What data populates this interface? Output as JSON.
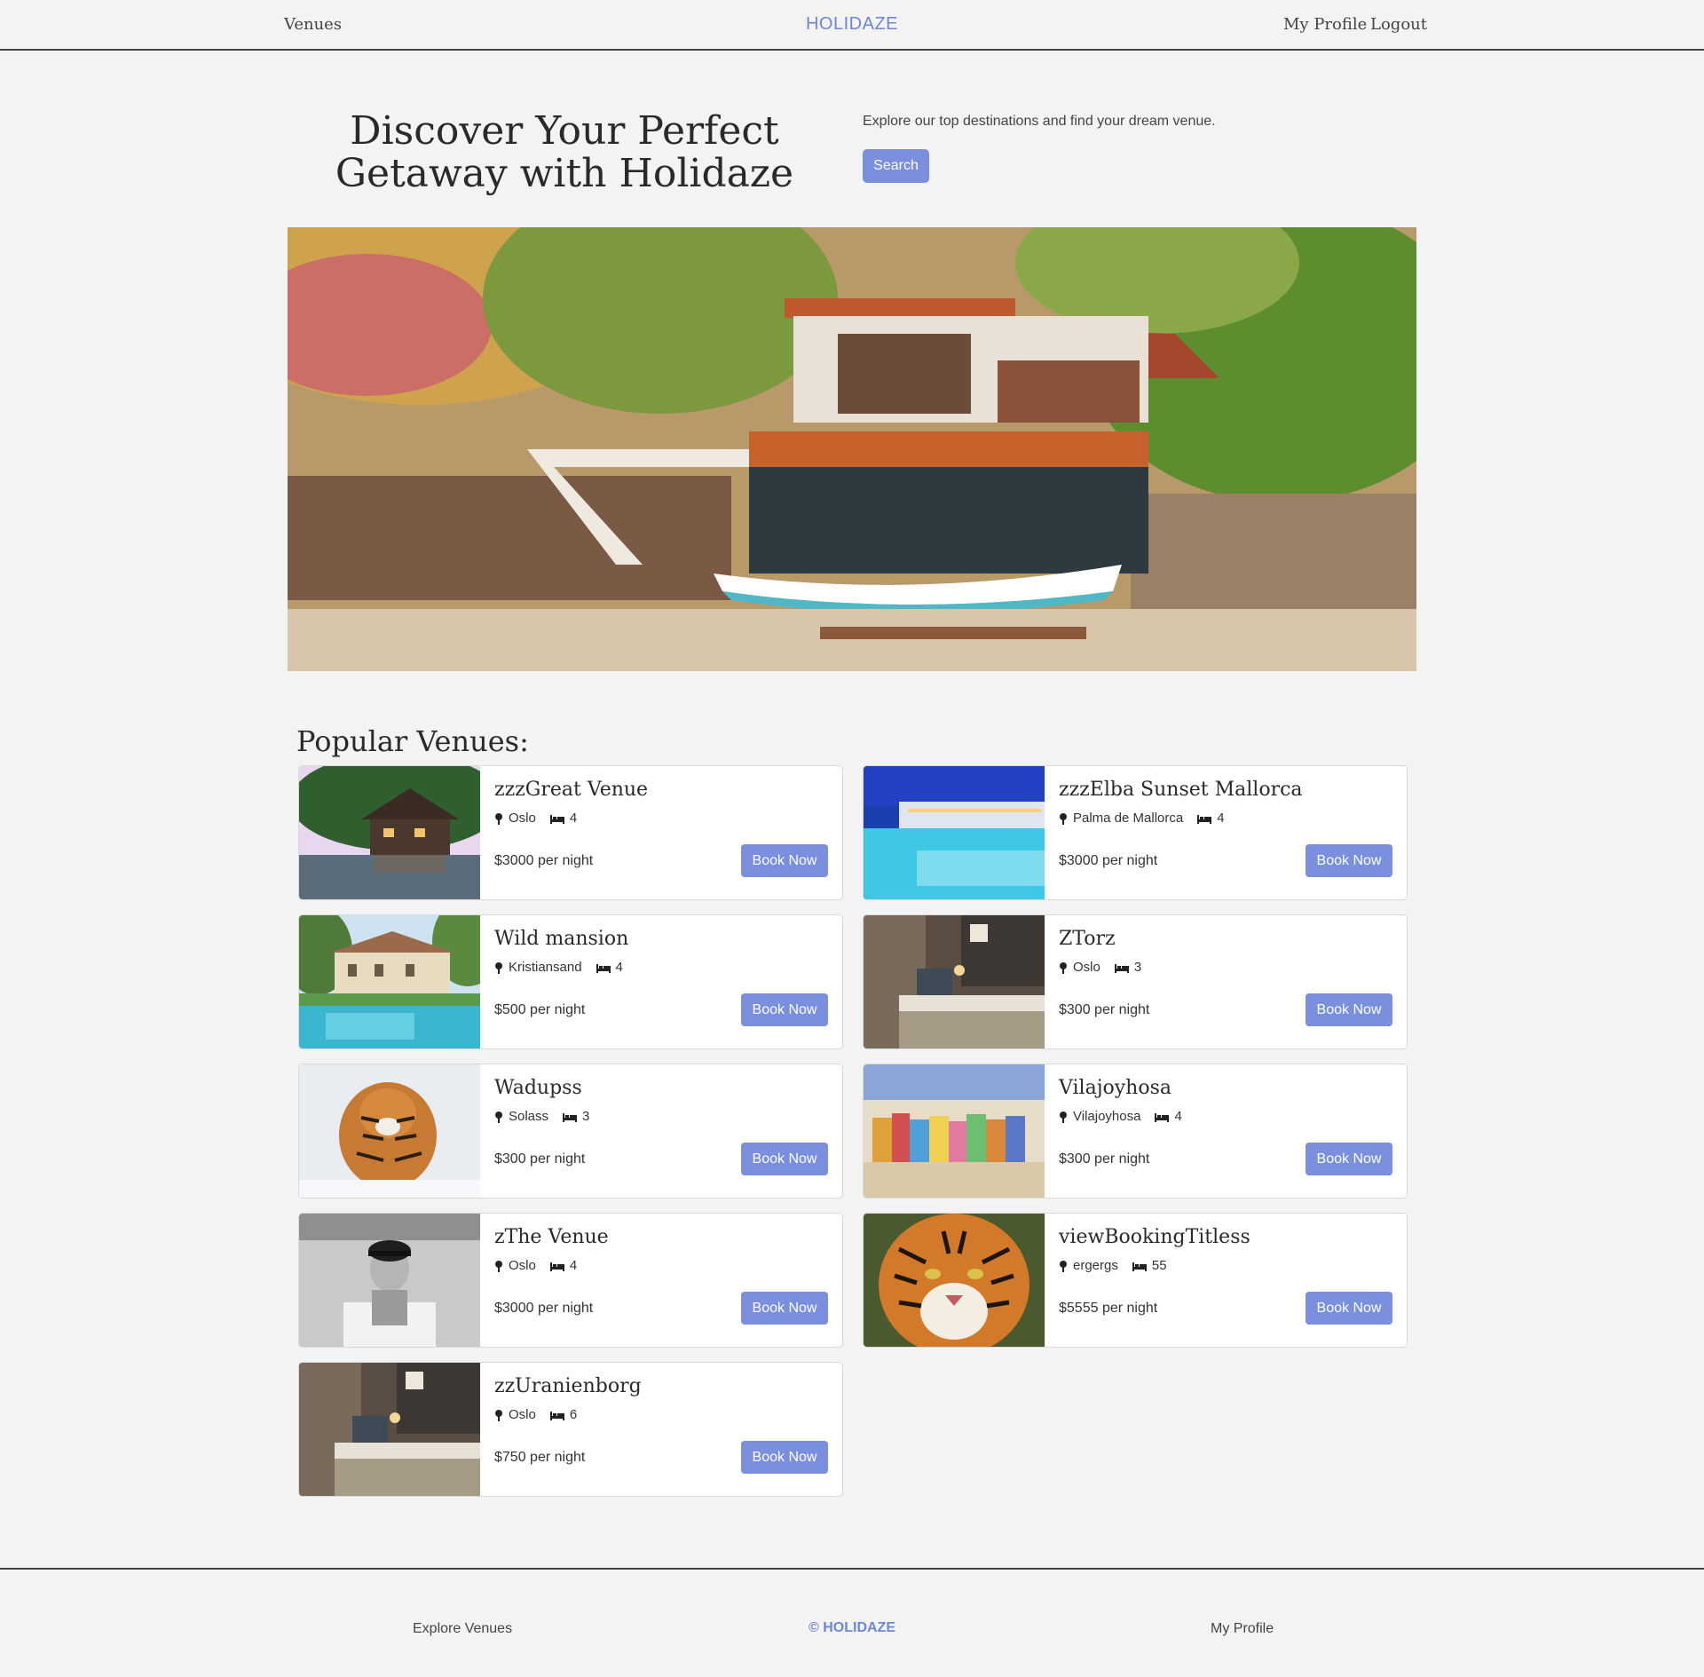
{
  "header": {
    "venues_label": "Venues",
    "brand": "HOLIDAZE",
    "profile_label": "My Profile",
    "logout_label": "Logout"
  },
  "hero": {
    "title": "Discover Your Perfect Getaway with Holidaze",
    "description": "Explore our top destinations and find your dream venue.",
    "search_label": "Search"
  },
  "popular": {
    "title": "Popular Venues:",
    "book_label": "Book Now",
    "venues": [
      {
        "name": "zzzGreat Venue",
        "location": "Oslo",
        "guests": "4",
        "price": "$3000 per night",
        "image": "lake-house"
      },
      {
        "name": "zzzElba Sunset Mallorca",
        "location": "Palma de Mallorca",
        "guests": "4",
        "price": "$3000 per night",
        "image": "resort-pool"
      },
      {
        "name": "Wild mansion",
        "location": "Kristiansand",
        "guests": "4",
        "price": "$500 per night",
        "image": "mansion-pool"
      },
      {
        "name": "ZTorz",
        "location": "Oslo",
        "guests": "3",
        "price": "$300 per night",
        "image": "hotel-bedroom"
      },
      {
        "name": "Wadupss",
        "location": "Solass",
        "guests": "3",
        "price": "$300 per night",
        "image": "tiger-snow"
      },
      {
        "name": "Vilajoyhosa",
        "location": "Vilajoyhosa",
        "guests": "4",
        "price": "$300 per night",
        "image": "colorful-town"
      },
      {
        "name": "zThe Venue",
        "location": "Oslo",
        "guests": "4",
        "price": "$3000 per night",
        "image": "person-bw"
      },
      {
        "name": "viewBookingTitless",
        "location": "ergergs",
        "guests": "55",
        "price": "$5555 per night",
        "image": "tiger-face"
      },
      {
        "name": "zzUranienborg",
        "location": "Oslo",
        "guests": "6",
        "price": "$750 per night",
        "image": "hotel-bedroom"
      }
    ]
  },
  "footer": {
    "explore_label": "Explore Venues",
    "brand": "© HOLIDAZE",
    "profile_label": "My Profile"
  },
  "colors": {
    "accent": "#7a8fde",
    "brand": "#6f86d6",
    "background": "#f3f3f3"
  }
}
